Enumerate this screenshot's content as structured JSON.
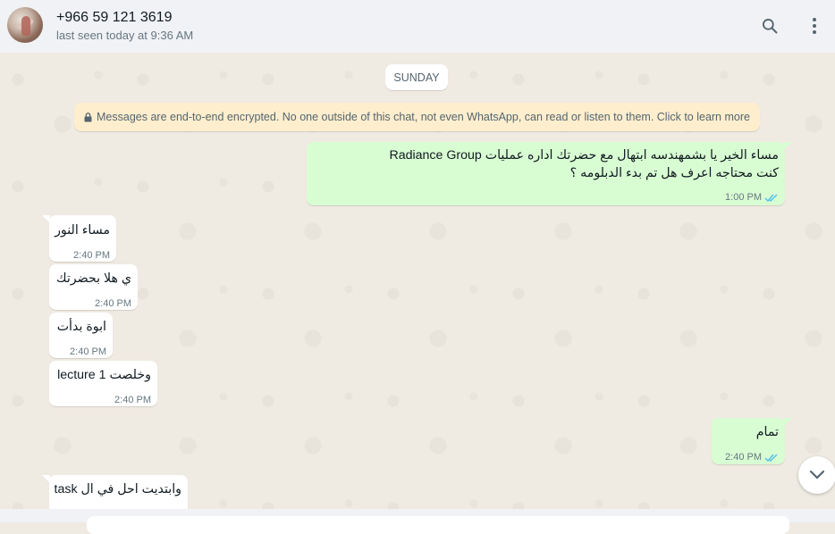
{
  "header": {
    "contact_name": "+966 59 121 3619",
    "status": "last seen today at 9:36 AM",
    "search_icon": "search-icon",
    "menu_icon": "more-vertical-icon"
  },
  "chat": {
    "day_label": "SUNDAY",
    "encryption_notice": "Messages are end-to-end encrypted. No one outside of this chat, not even WhatsApp, can read or listen to them. Click to learn more",
    "messages": [
      {
        "direction": "out",
        "line1": "مساء الخير يا بشمهندسه ابتهال مع حضرتك اداره عمليات Radiance Group",
        "line2": "كنت محتاجه اعرف هل تم بدء الدبلومه ؟",
        "time": "1:00 PM",
        "status": "read"
      },
      {
        "direction": "in",
        "text": "مساء النور",
        "time": "2:40 PM"
      },
      {
        "direction": "in",
        "text": "ي هلا بحضرتك",
        "time": "2:40 PM"
      },
      {
        "direction": "in",
        "text": "ابوة بدأت",
        "time": "2:40 PM"
      },
      {
        "direction": "in",
        "text": "وخلصت lecture 1",
        "time": "2:40 PM"
      },
      {
        "direction": "out",
        "text": "تمام",
        "time": "2:40 PM",
        "status": "read"
      },
      {
        "direction": "in",
        "text": "وابتديت احل في ال task",
        "time": ""
      }
    ]
  },
  "colors": {
    "outgoing_bubble": "#d9fdd3",
    "incoming_bubble": "#ffffff",
    "read_ticks": "#53bdeb",
    "chat_background": "#efeae2",
    "banner": "#ffeecd"
  }
}
